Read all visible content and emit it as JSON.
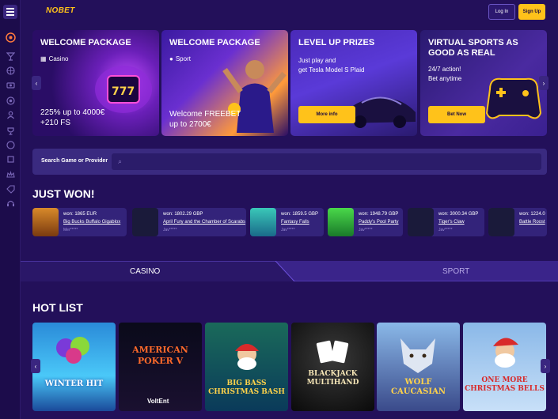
{
  "header": {
    "logo": "NOBET",
    "login_label": "Log In",
    "signup_label": "Sign Up"
  },
  "sidebar": {
    "icons": [
      "roulette-icon",
      "cocktail-icon",
      "basketball-icon",
      "camera-icon",
      "chip-icon",
      "user-icon",
      "cup-icon",
      "ticket-icon",
      "layers-icon",
      "crown-icon",
      "tag-icon",
      "support-icon"
    ]
  },
  "promos": [
    {
      "title": "WELCOME PACKAGE",
      "tag": "Casino",
      "line1": "225% up to 4000€",
      "line2": "+210 FS"
    },
    {
      "title": "WELCOME PACKAGE",
      "tag": "Sport",
      "line1": "Welcome FREEBET",
      "line2": "up to 2700€"
    },
    {
      "title": "LEVEL UP PRIZES",
      "line1": "Just play and",
      "line2": "get Tesla Model S Plaid",
      "button": "More info"
    },
    {
      "title": "VIRTUAL SPORTS AS GOOD AS REAL",
      "line1": "24/7 action!",
      "line2": "Bet anytime",
      "button": "Bet Now"
    }
  ],
  "search": {
    "label": "Search Game or Provider",
    "placeholder": ""
  },
  "just_won": {
    "title": "JUST WON!",
    "items": [
      {
        "amount": "won: 1865 EUR",
        "game": "Big Bucks Buffalo Gigablox",
        "user": "Mer*****"
      },
      {
        "amount": "won: 1802.29 GBP",
        "game": "April Fury and the Chamber of Scarabs",
        "user": "Jav*****"
      },
      {
        "amount": "won: 1859.5 GBP",
        "game": "Fantasy Falls",
        "user": "Jav*****"
      },
      {
        "amount": "won: 1948.79 GBP",
        "game": "Paddy's Pool Party",
        "user": "Jav*****"
      },
      {
        "amount": "won: 3000.34 GBP",
        "game": "Tiger's Claw",
        "user": "Jav*****"
      },
      {
        "amount": "won: 1224.0",
        "game": "Battle Roost",
        "user": ""
      }
    ]
  },
  "tabs": {
    "casino": "CASINO",
    "sport": "SPORT"
  },
  "hot_list": {
    "title": "HOT LIST",
    "games": [
      {
        "name": "WINTER HIT"
      },
      {
        "name": "AMERICAN POKER V",
        "provider": "VoltEnt"
      },
      {
        "name": "BIG BASS CHRISTMAS BASH"
      },
      {
        "name": "BLACKJACK MULTIHAND"
      },
      {
        "name": "WOLF CAUCASIAN"
      },
      {
        "name": "ONE MORE CHRISTMAS BELLS"
      }
    ]
  },
  "colors": {
    "background": "#23105a",
    "accent": "#ffc21a",
    "card": "#33237a"
  }
}
